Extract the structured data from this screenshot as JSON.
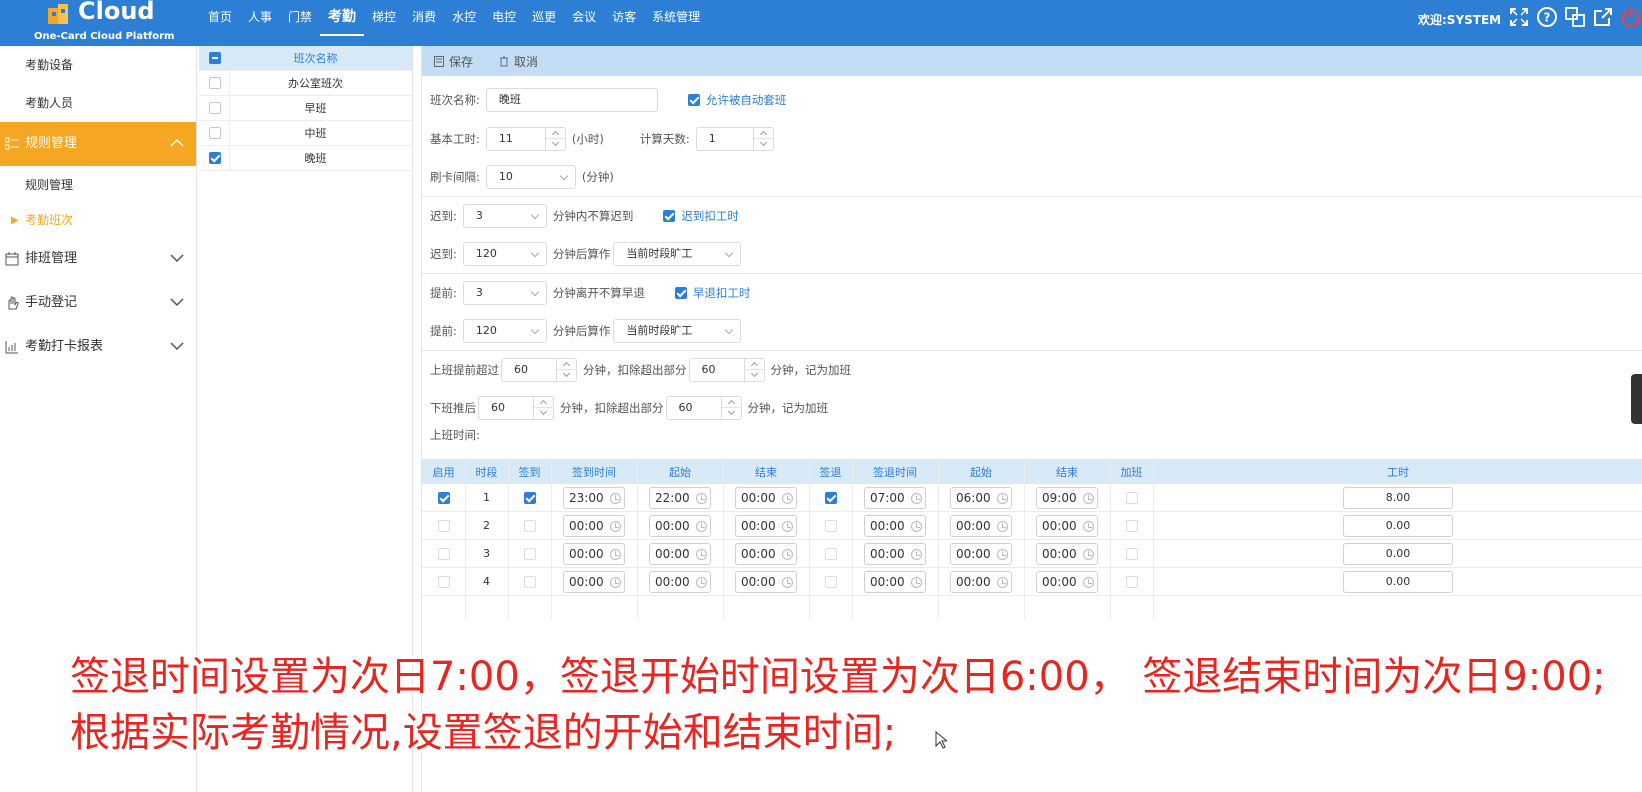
{
  "app": {
    "logo_text": "Cloud",
    "logo_subtitle": "One-Card Cloud Platform",
    "nav": [
      "首页",
      "人事",
      "门禁",
      "考勤",
      "梯控",
      "消费",
      "水控",
      "电控",
      "巡更",
      "会议",
      "访客",
      "系统管理"
    ],
    "nav_active": "考勤",
    "welcome": "欢迎:SYSTEM",
    "header_icons": [
      "fullscreen-icon",
      "help-icon",
      "switch-icon",
      "external-link-icon",
      "power-icon"
    ]
  },
  "sidebar": {
    "top_items": [
      "考勤设备",
      "考勤人员"
    ],
    "active_group": "规则管理",
    "active_group_items": [
      "规则管理"
    ],
    "current_item": "考勤班次",
    "groups": [
      "排班管理",
      "手动登记",
      "考勤打卡报表"
    ]
  },
  "shift_list": {
    "header": "班次名称",
    "items": [
      {
        "name": "办公室班次",
        "checked": false
      },
      {
        "name": "早班",
        "checked": false
      },
      {
        "name": "中班",
        "checked": false
      },
      {
        "name": "晚班",
        "checked": true
      }
    ]
  },
  "toolbar": {
    "save": "保存",
    "cancel": "取消"
  },
  "form": {
    "shift_name_label": "班次名称:",
    "shift_name_value": "晚班",
    "auto_label": "允许被自动套班",
    "base_hours_label": "基本工时:",
    "base_hours_value": "11",
    "base_hours_unit": "(小时)",
    "calc_days_label": "计算天数:",
    "calc_days_value": "1",
    "swipe_interval_label": "刷卡间隔:",
    "swipe_interval_value": "10",
    "swipe_interval_unit": "(分钟)",
    "late1_label": "迟到:",
    "late1_value": "3",
    "late1_text": "分钟内不算迟到",
    "late_deduct_label": "迟到扣工时",
    "late2_label": "迟到:",
    "late2_value": "120",
    "late2_text": "分钟后算作",
    "late2_select": "当前时段旷工",
    "early1_label": "提前:",
    "early1_value": "3",
    "early1_text": "分钟离开不算早退",
    "early_deduct_label": "早退扣工时",
    "early2_label": "提前:",
    "early2_value": "120",
    "early2_text": "分钟后算作",
    "early2_select": "当前时段旷工",
    "ot_before_label": "上班提前超过",
    "ot_before_value": "60",
    "ot_before_text": "分钟，扣除超出部分",
    "ot_before_value2": "60",
    "ot_before_text2": "分钟，记为加班",
    "ot_after_label": "下班推后",
    "ot_after_value": "60",
    "ot_after_text": "分钟，扣除超出部分",
    "ot_after_value2": "60",
    "ot_after_text2": "分钟，记为加班",
    "work_time_label": "上班时间:"
  },
  "table": {
    "headers": [
      "启用",
      "时段",
      "签到",
      "签到时间",
      "起始",
      "结束",
      "签退",
      "签退时间",
      "起始",
      "结束",
      "加班",
      "工时"
    ],
    "rows": [
      {
        "enabled": true,
        "period": "1",
        "signin": true,
        "signin_time": "23:00",
        "start": "22:00",
        "end": "00:00",
        "signout": true,
        "signout_time": "07:00",
        "out_start": "06:00",
        "out_end": "09:00",
        "overtime": false,
        "hours": "8.00"
      },
      {
        "enabled": false,
        "period": "2",
        "signin": false,
        "signin_time": "00:00",
        "start": "00:00",
        "end": "00:00",
        "signout": false,
        "signout_time": "00:00",
        "out_start": "00:00",
        "out_end": "00:00",
        "overtime": false,
        "hours": "0.00"
      },
      {
        "enabled": false,
        "period": "3",
        "signin": false,
        "signin_time": "00:00",
        "start": "00:00",
        "end": "00:00",
        "signout": false,
        "signout_time": "00:00",
        "out_start": "00:00",
        "out_end": "00:00",
        "overtime": false,
        "hours": "0.00"
      },
      {
        "enabled": false,
        "period": "4",
        "signin": false,
        "signin_time": "00:00",
        "start": "00:00",
        "end": "00:00",
        "signout": false,
        "signout_time": "00:00",
        "out_start": "00:00",
        "out_end": "00:00",
        "overtime": false,
        "hours": "0.00"
      }
    ]
  },
  "subtitles": [
    "签退时间设置为次日7:00，签退开始时间设置为次日6:00，  签退结束时间为次日9:00;",
    "根据实际考勤情况,设置签退的开始和结束时间;"
  ],
  "colors": {
    "header": "#2d7fd6",
    "accent": "#f5a623",
    "subtitle": "#e8261f"
  }
}
